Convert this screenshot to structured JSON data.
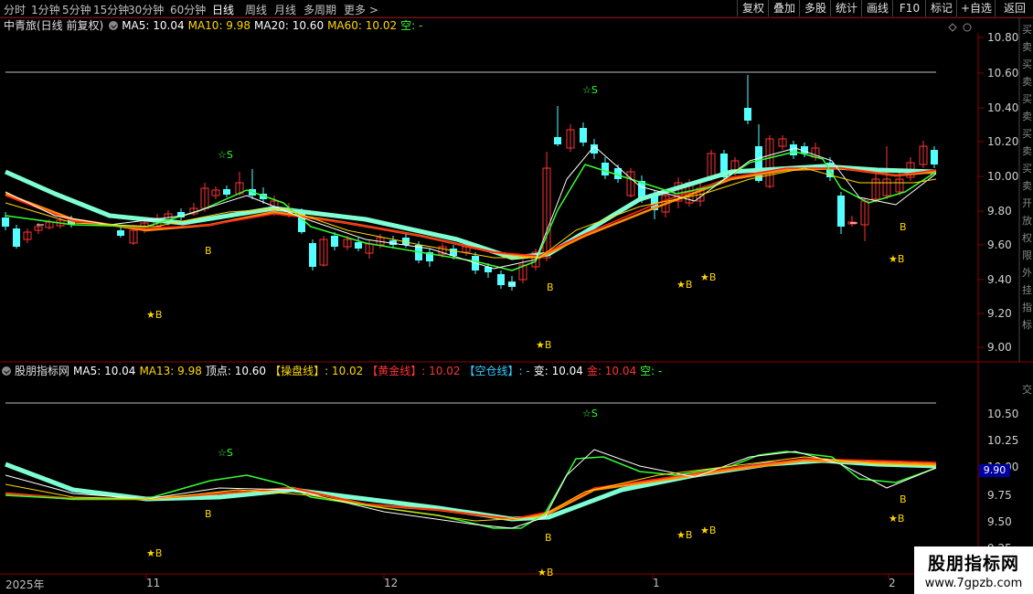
{
  "toolbar": {
    "periods": [
      "分时",
      "1分钟",
      "5分钟",
      "15分钟",
      "30分钟",
      "60分钟",
      "日线",
      "周线",
      "月线",
      "多周期",
      "更多 >"
    ],
    "active_period": "日线",
    "right_buttons": [
      "复权",
      "叠加",
      "多股",
      "统计",
      "画线",
      "F10",
      "标记",
      "+自选",
      "返回"
    ]
  },
  "main_panel": {
    "title": "中青旅(日线 前复权)",
    "indicators": [
      {
        "label": "MA5: 10.04",
        "color": "#ffffff"
      },
      {
        "label": "MA10: 9.98",
        "color": "#ffd700"
      },
      {
        "label": "MA20: 10.60",
        "color": "#ffffff"
      },
      {
        "label": "MA60: 10.02",
        "color": "#ffd700"
      },
      {
        "label": "空: -",
        "color": "#33ff33"
      }
    ],
    "y_ticks": [
      "10.80",
      "10.60",
      "10.40",
      "10.20",
      "10.00",
      "9.80",
      "9.60",
      "9.40",
      "9.20",
      "9.00"
    ],
    "side_text": "买卖买卖买卖买卖买卖开放权限外挂指标"
  },
  "sub_panel": {
    "title": "股朋指标网",
    "indicators": [
      {
        "label": "MA5: 10.04",
        "color": "#ffffff"
      },
      {
        "label": "MA13: 9.98",
        "color": "#ffd700"
      },
      {
        "label": "顶点: 10.60",
        "color": "#ffffff"
      },
      {
        "label": "【操盘线】: 10.02",
        "color": "#ffd700"
      },
      {
        "label": "【黄金线】: 10.02",
        "color": "#ff3333"
      },
      {
        "label": "【空仓线】: -",
        "color": "#33ccff"
      },
      {
        "label": "变: 10.04",
        "color": "#ffffff"
      },
      {
        "label": "金: 10.04",
        "color": "#ff3333"
      },
      {
        "label": "空: -",
        "color": "#33ff33"
      }
    ],
    "y_ticks": [
      "10.50",
      "10.25",
      "10.00",
      "9.75",
      "9.50",
      "9.25"
    ],
    "current_value": "9.90",
    "side_text": "交"
  },
  "signals": {
    "sell": "☆S",
    "buy": "B",
    "star_buy": "★B"
  },
  "x_axis": {
    "labels": [
      "2025年",
      "11",
      "12",
      "1",
      "2"
    ]
  },
  "watermark": {
    "line1": "股朋指标网",
    "line2": "www.7gpzb.com"
  },
  "colors": {
    "up": "#ff3333",
    "down": "#54ffff",
    "ma_white": "#ffffff",
    "ma_yellow": "#ffd700",
    "green_line": "#33ff33",
    "cyan_thick": "#7fffd4",
    "red_line": "#ff2020",
    "orange_line": "#ff8c00"
  }
}
